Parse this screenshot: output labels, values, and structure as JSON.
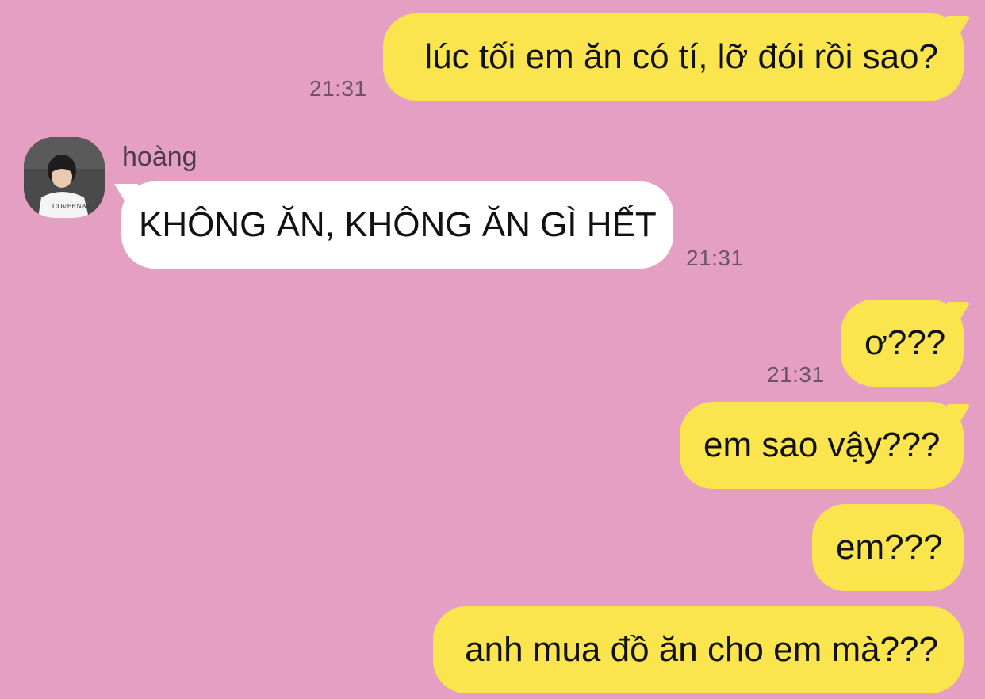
{
  "messages": [
    {
      "direction": "outgoing",
      "text": "lúc tối em ăn có tí, lỡ đói rồi sao?",
      "time": "21:31"
    },
    {
      "direction": "incoming",
      "sender": "hoàng",
      "text": "KHÔNG ĂN, KHÔNG ĂN GÌ HẾT",
      "time": "21:31"
    },
    {
      "direction": "outgoing",
      "text": "ơ???",
      "time": "21:31"
    },
    {
      "direction": "outgoing",
      "text": "em sao vậy???"
    },
    {
      "direction": "outgoing",
      "text": "em???"
    },
    {
      "direction": "outgoing",
      "text": "anh mua đồ ăn cho em mà???"
    }
  ],
  "avatar": {
    "icon": "user-avatar-photo",
    "shirt_text": "COVERNAT"
  },
  "colors": {
    "background": "#e49fc2",
    "outgoing_bubble": "#fbe54e",
    "incoming_bubble": "#ffffff",
    "timestamp": "#6b5466"
  }
}
